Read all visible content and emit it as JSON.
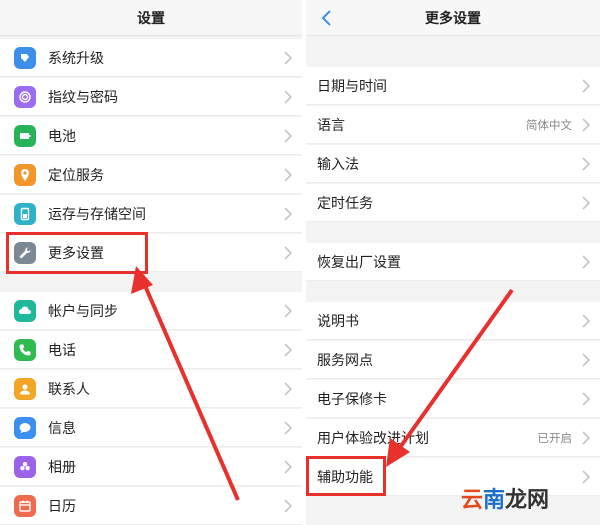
{
  "left": {
    "title": "设置",
    "group1": [
      {
        "label": "系统升级",
        "icon": "system-update-icon",
        "color": "#3d8ee9"
      },
      {
        "label": "指纹与密码",
        "icon": "fingerprint-icon",
        "color": "#9b6cf0"
      },
      {
        "label": "电池",
        "icon": "battery-icon",
        "color": "#27b35a"
      },
      {
        "label": "定位服务",
        "icon": "location-icon",
        "color": "#f2952a"
      },
      {
        "label": "运存与存储空间",
        "icon": "storage-icon",
        "color": "#2eb1c9"
      },
      {
        "label": "更多设置",
        "icon": "wrench-icon",
        "color": "#7c8896"
      }
    ],
    "group2": [
      {
        "label": "帐户与同步",
        "icon": "cloud-sync-icon",
        "color": "#1fb89a"
      },
      {
        "label": "电话",
        "icon": "phone-icon",
        "color": "#2fbb4f"
      },
      {
        "label": "联系人",
        "icon": "contacts-icon",
        "color": "#f2a623"
      },
      {
        "label": "信息",
        "icon": "message-icon",
        "color": "#3a8ff0"
      },
      {
        "label": "相册",
        "icon": "gallery-icon",
        "color": "#9c63e8"
      },
      {
        "label": "日历",
        "icon": "calendar-icon",
        "color": "#f06a4d"
      }
    ]
  },
  "right": {
    "title": "更多设置",
    "group1": [
      {
        "label": "日期与时间",
        "value": ""
      },
      {
        "label": "语言",
        "value": "简体中文"
      },
      {
        "label": "输入法",
        "value": ""
      },
      {
        "label": "定时任务",
        "value": ""
      }
    ],
    "group2": [
      {
        "label": "恢复出厂设置",
        "value": ""
      }
    ],
    "group3": [
      {
        "label": "说明书",
        "value": ""
      },
      {
        "label": "服务网点",
        "value": ""
      },
      {
        "label": "电子保修卡",
        "value": ""
      },
      {
        "label": "用户体验改进计划",
        "value": "已开启"
      },
      {
        "label": "辅助功能",
        "value": ""
      }
    ]
  },
  "watermark": {
    "part1": "云",
    "part2": "南",
    "part3": "龙网"
  },
  "colors": {
    "highlight": "#e8302c",
    "accent": "#3d8ee9"
  }
}
